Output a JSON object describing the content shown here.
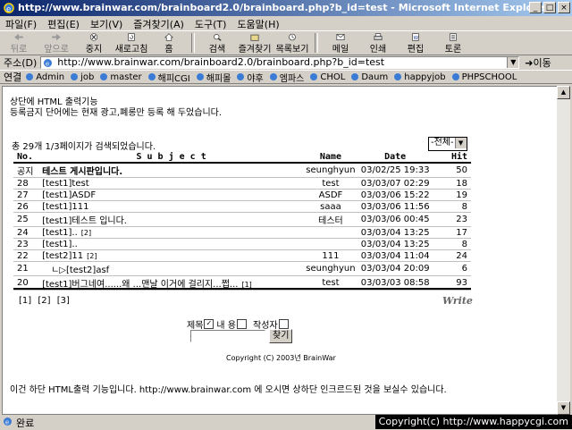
{
  "window": {
    "title": "http://www.brainwar.com/brainboard2.0/brainboard.php?b_id=test - Microsoft Internet Explorer"
  },
  "menu": [
    "파일(F)",
    "편집(E)",
    "보기(V)",
    "즐겨찾기(A)",
    "도구(T)",
    "도움말(H)"
  ],
  "toolbar": {
    "back": "뒤로",
    "forward": "앞으로",
    "stop": "중지",
    "refresh": "새로고침",
    "home": "홈",
    "search": "검색",
    "favorites": "즐겨찾기",
    "history": "목록보기",
    "mail": "메일",
    "print": "인쇄",
    "edit": "편집",
    "discuss": "토론"
  },
  "address": {
    "label": "주소(D)",
    "url": "http://www.brainwar.com/brainboard2.0/brainboard.php?b_id=test",
    "go": "이동"
  },
  "links": {
    "label": "연결",
    "items": [
      "Admin",
      "job",
      "master",
      "해피CGI",
      "해피몰",
      "야후",
      "엠파스",
      "CHOL",
      "Daum",
      "happyjob",
      "PHPSCHOOL"
    ]
  },
  "page": {
    "top_msg_1": "상단에 HTML 출력기능",
    "top_msg_2": "등록금지 단어에는 현재 광고,폐롱만 등록 해 두었습니다.",
    "count_line": "총 29개  1/3페이지가 검색되었습니다.",
    "filter_value": "-전체-",
    "columns": {
      "no": "No.",
      "subject": "S u b j e c t",
      "name": "Name",
      "date": "Date",
      "hit": "Hit"
    },
    "rows": [
      {
        "no": "공지",
        "subject": "테스트 게시판입니다.",
        "reply_count": "",
        "name": "seunghyun",
        "date": "03/02/25 19:33",
        "hit": "50"
      },
      {
        "no": "28",
        "subject": "[test1]test",
        "reply_count": "",
        "name": "test",
        "date": "03/03/07 02:29",
        "hit": "18"
      },
      {
        "no": "27",
        "subject": "[test1]ASDF",
        "reply_count": "",
        "name": "ASDF",
        "date": "03/03/06 15:22",
        "hit": "19"
      },
      {
        "no": "26",
        "subject": "[test1]111",
        "reply_count": "",
        "name": "saaa",
        "date": "03/03/06 11:56",
        "hit": "8"
      },
      {
        "no": "25",
        "subject": "[test1]테스트 입니다.",
        "reply_count": "",
        "name": "테스터",
        "date": "03/03/06 00:45",
        "hit": "23"
      },
      {
        "no": "24",
        "subject": "[test1]..",
        "reply_count": "[2]",
        "name": "",
        "date": "03/03/04 13:25",
        "hit": "17"
      },
      {
        "no": "23",
        "subject": "[test1]..",
        "reply_count": "",
        "name": "",
        "date": "03/03/04 13:25",
        "hit": "8"
      },
      {
        "no": "22",
        "subject": "[test2]11",
        "reply_count": "[2]",
        "name": "111",
        "date": "03/03/04 11:04",
        "hit": "24"
      },
      {
        "no": "21",
        "subject": "[test2]asf",
        "reply_count": "",
        "name": "seunghyun",
        "date": "03/03/04 20:09",
        "hit": "6",
        "reply": "ㄴ▷"
      },
      {
        "no": "20",
        "subject": "[test1]버그네여......왜 ...맨날 이거에 걸리지...쩝...",
        "reply_count": "[1]",
        "name": "test",
        "date": "03/03/03 08:58",
        "hit": "93"
      }
    ],
    "pages": [
      "[1]",
      "[2]",
      "[3]"
    ],
    "write": "Write",
    "search_opts": {
      "subject": "제목",
      "content": "내  용",
      "author": "작성자"
    },
    "search_button": "찾기",
    "copyright": "Copyright (C) 2003년 BrainWar",
    "bottom_msg": "이건 하단 HTML출력 기능입니다. http://www.brainwar.com 에 오시면 상하단 인크르드된 것을 보실수 있습니다."
  },
  "status": {
    "text": "완료",
    "badge": "Copyright(c) http://www.happycgi.com"
  }
}
